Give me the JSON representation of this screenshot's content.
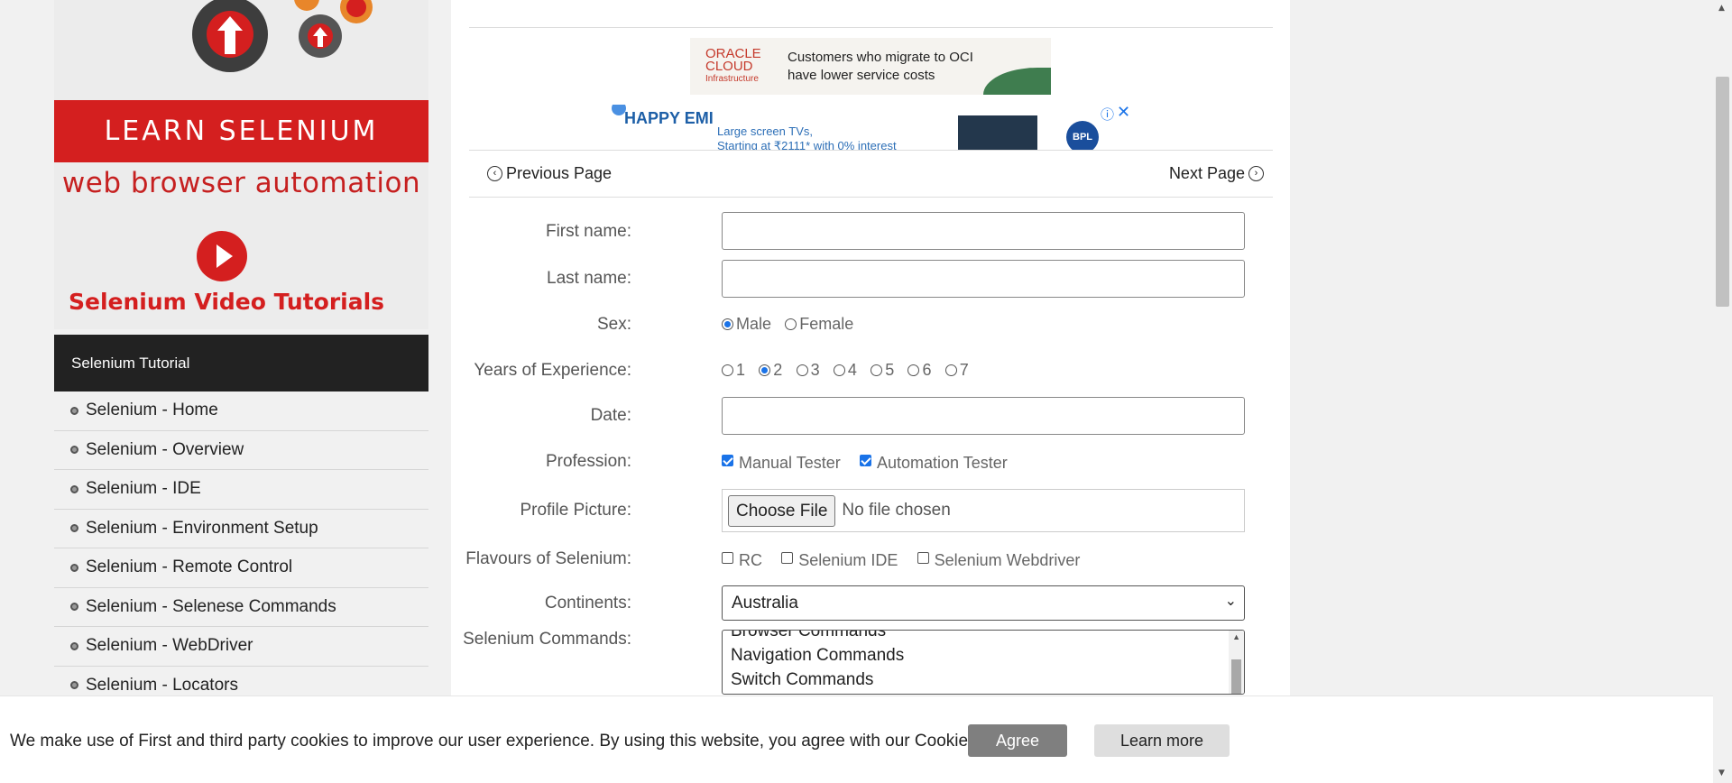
{
  "sidebar": {
    "banner_title": "LEARN SELENIUM",
    "banner_subtitle": "web browser automation",
    "video_title": "Selenium Video Tutorials",
    "header": "Selenium Tutorial",
    "items": [
      {
        "label": "Selenium - Home"
      },
      {
        "label": "Selenium - Overview"
      },
      {
        "label": "Selenium - IDE"
      },
      {
        "label": "Selenium - Environment Setup"
      },
      {
        "label": "Selenium - Remote Control"
      },
      {
        "label": "Selenium - Selenese Commands"
      },
      {
        "label": "Selenium - WebDriver"
      },
      {
        "label": "Selenium - Locators"
      }
    ]
  },
  "ads": {
    "oracle_logo": "ORACLE CLOUD",
    "oracle_logo_sub": "Infrastructure",
    "oracle_line1": "Customers who migrate to OCI",
    "oracle_line2": "have lower service costs",
    "bpl_logo": "HAPPY EMI",
    "bpl_line1": "Large screen TVs,",
    "bpl_line2": "Starting at ₹2111* with 0% interest",
    "bpl_brand": "BPL",
    "info_icon": "ⓘ",
    "close_icon": "✕"
  },
  "pager": {
    "prev_label": "Previous Page",
    "next_label": "Next Page"
  },
  "form": {
    "first_name_label": "First name:",
    "first_name_value": "",
    "last_name_label": "Last name:",
    "last_name_value": "",
    "sex_label": "Sex:",
    "sex_options": [
      "Male",
      "Female"
    ],
    "sex_selected": "Male",
    "exp_label": "Years of Experience:",
    "exp_options": [
      "1",
      "2",
      "3",
      "4",
      "5",
      "6",
      "7"
    ],
    "exp_selected": "2",
    "date_label": "Date:",
    "date_value": "",
    "profession_label": "Profession:",
    "profession_options": [
      "Manual Tester",
      "Automation Tester"
    ],
    "profession_checked": [
      "Manual Tester",
      "Automation Tester"
    ],
    "picture_label": "Profile Picture:",
    "choose_file": "Choose File",
    "file_status": "No file chosen",
    "flavours_label": "Flavours of Selenium:",
    "flavours_options": [
      "RC",
      "Selenium IDE",
      "Selenium Webdriver"
    ],
    "continents_label": "Continents:",
    "continents_value": "Australia",
    "commands_label": "Selenium Commands:",
    "commands_items": [
      "Browser Commands",
      "Navigation Commands",
      "Switch Commands"
    ]
  },
  "cookie": {
    "text": "We make use of First and third party cookies to improve our user experience. By using this website, you agree with our Cookies Policy.",
    "agree": "Agree",
    "learn_more": "Learn more"
  },
  "colors": {
    "accent_red": "#d41f1f",
    "radio_blue": "#1a73e8",
    "sidebar_head_bg": "#222222"
  }
}
